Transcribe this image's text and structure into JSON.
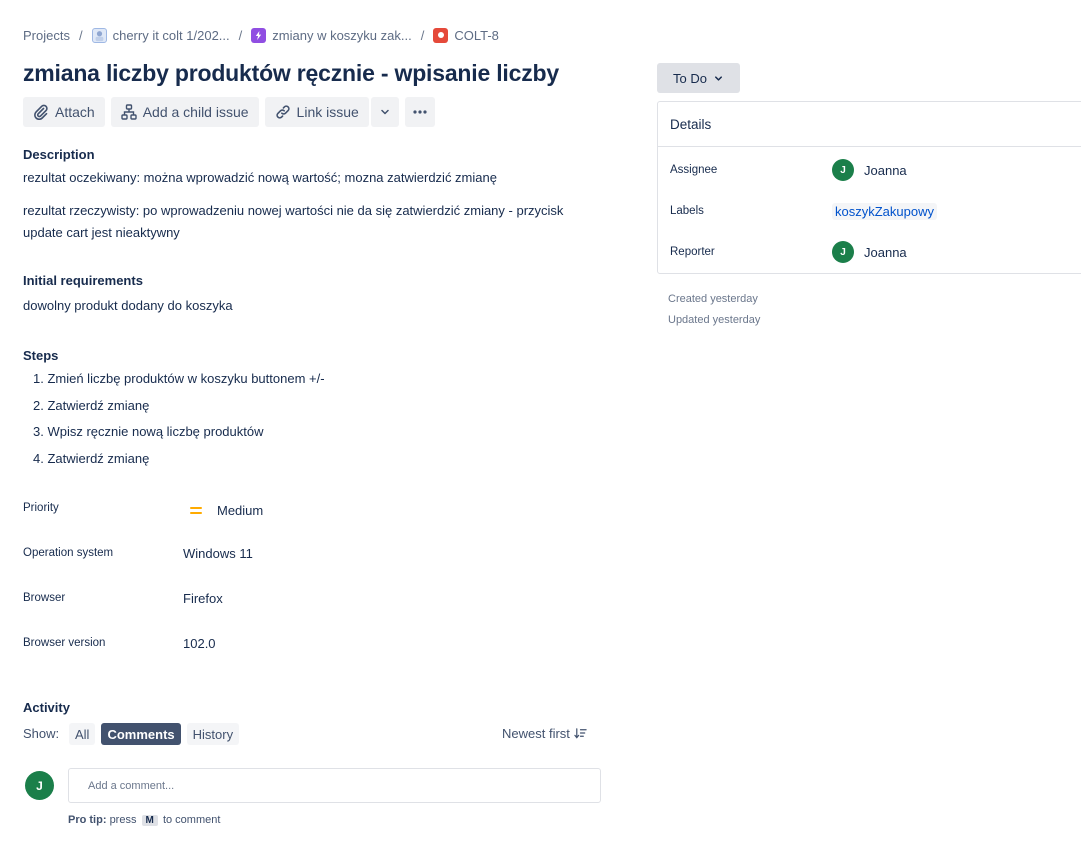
{
  "breadcrumb": {
    "root": "Projects",
    "separator": "/",
    "project": "cherry it colt 1/202...",
    "epic": "zmiany w koszyku zak...",
    "issue_key": "COLT-8"
  },
  "issue": {
    "title": "zmiana liczby produktów ręcznie - wpisanie liczby"
  },
  "toolbar": {
    "attach": "Attach",
    "add_child": "Add a child issue",
    "link_issue": "Link issue"
  },
  "description": {
    "heading": "Description",
    "line1": "rezultat oczekiwany: można wprowadzić nową wartość; mozna zatwierdzić zmianę",
    "line2a": "rezultat rzeczywisty: po wprowadzeniu nowej wartości nie da się zatwierdzić zmiany - przycisk",
    "line2b": "update cart jest nieaktywny"
  },
  "requirements": {
    "heading": "Initial requirements",
    "text": "dowolny produkt dodany do koszyka"
  },
  "steps": {
    "heading": "Steps",
    "items": [
      "1. Zmień liczbę produktów w koszyku buttonem +/-",
      "2. Zatwierdź zmianę",
      "3. Wpisz ręcznie nową liczbę produktów",
      "4. Zatwierdź zmianę"
    ]
  },
  "fields": {
    "priority_label": "Priority",
    "priority_value": "Medium",
    "priority_color": "#ffab00",
    "os_label": "Operation system",
    "os_value": "Windows 11",
    "browser_label": "Browser",
    "browser_value": "Firefox",
    "browser_version_label": "Browser version",
    "browser_version_value": "102.0"
  },
  "activity": {
    "heading": "Activity",
    "show_label": "Show:",
    "filters": [
      "All",
      "Comments",
      "History"
    ],
    "active_filter": "Comments",
    "sort": "Newest first",
    "comment_placeholder": "Add a comment...",
    "avatar_initial": "J",
    "protip_bold": "Pro tip:",
    "protip_press": "press",
    "protip_key": "M",
    "protip_rest": "to comment"
  },
  "status": {
    "label": "To Do"
  },
  "details": {
    "heading": "Details",
    "assignee_label": "Assignee",
    "assignee_name": "Joanna",
    "assignee_initial": "J",
    "labels_label": "Labels",
    "label_value": "koszykZakupowy",
    "reporter_label": "Reporter",
    "reporter_name": "Joanna",
    "reporter_initial": "J",
    "avatar_color": "#1b7f4a"
  },
  "meta": {
    "created": "Created yesterday",
    "updated": "Updated yesterday"
  }
}
